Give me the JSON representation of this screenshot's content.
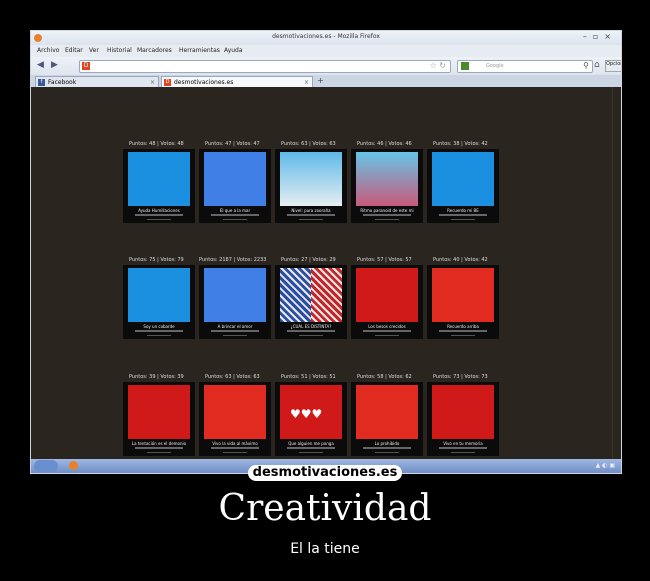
{
  "browser": {
    "window_title": "desmotivaciones.es - Mozilla Firefox",
    "menu": [
      "Archivo",
      "Editar",
      "Ver",
      "Historial",
      "Marcadores",
      "Herramientas",
      "Ayuda"
    ],
    "search_placeholder": "Google",
    "options_label": "Opciones",
    "tabs": [
      {
        "label": "Facebook"
      },
      {
        "label": "desmotivaciones.es"
      }
    ]
  },
  "grid": {
    "rows": [
      {
        "cards": [
          {
            "stats": "Puntos: 48 | Votos: 48",
            "caption": "Ayuda Humillaciones"
          },
          {
            "stats": "Puntos: 47 | Votos: 47",
            "caption": "El que a la mar"
          },
          {
            "stats": "Puntos: 63 | Votos: 63",
            "caption": "Nivel: pura zooraña"
          },
          {
            "stats": "Puntos: 46 | Votos: 46",
            "caption": "Ritmo paranoid de este mi"
          },
          {
            "stats": "Puntos: 38 | Votos: 42",
            "caption": "Recuerdo mi BE"
          }
        ]
      },
      {
        "cards": [
          {
            "stats": "Puntos: 75 | Votos: 79",
            "caption": "Soy un cobarde"
          },
          {
            "stats": "Puntos: 2187 | Votos: 2233",
            "caption": "A brincar el amor"
          },
          {
            "stats": "Puntos: 27 | Votos: 29",
            "caption": "¿CUÁL ES DISTINTA?"
          },
          {
            "stats": "Puntos: 57 | Votos: 57",
            "caption": "Los besos crecidos"
          },
          {
            "stats": "Puntos: 40 | Votos: 42",
            "caption": "Recuerdo arriba"
          }
        ]
      },
      {
        "cards": [
          {
            "stats": "Puntos: 39 | Votos: 39",
            "caption": "La tentación es el demonio"
          },
          {
            "stats": "Puntos: 63 | Votos: 63",
            "caption": "Vivo la vida al máximo"
          },
          {
            "stats": "Puntos: 51 | Votos: 51",
            "caption": "Que alguien me ponga"
          },
          {
            "stats": "Puntos: 58 | Votos: 62",
            "caption": "Lo prohibido"
          },
          {
            "stats": "Puntos: 73 | Votos: 73",
            "caption": "Vivo en tu memoria"
          }
        ]
      }
    ]
  },
  "site_brand": "desmotivaciones.es",
  "poster": {
    "title": "Creatividad",
    "subtitle": "El la tiene"
  },
  "colors": {
    "page_bg": "#000000",
    "content_bg": "#2b2520",
    "accent_blue": "#1b8fe0",
    "accent_red": "#d01a1a"
  }
}
